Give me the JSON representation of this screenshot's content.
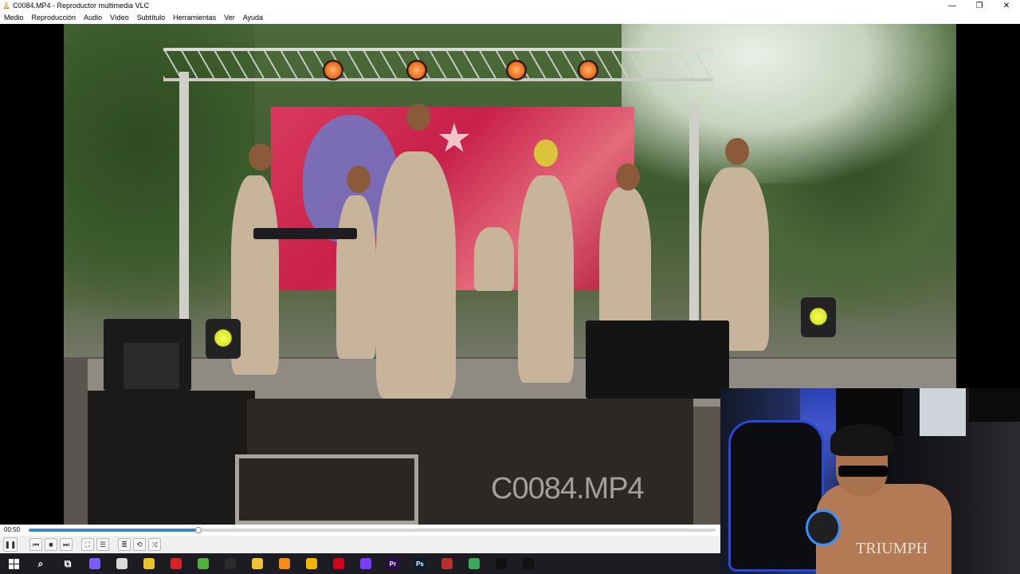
{
  "window": {
    "title": "C0084.MP4 - Reproductor multimedia VLC",
    "controls": {
      "minimize": "—",
      "restore": "❐",
      "close": "✕"
    }
  },
  "menu": [
    "Medio",
    "Reproducción",
    "Audio",
    "Vídeo",
    "Subtítulo",
    "Herramientas",
    "Ver",
    "Ayuda"
  ],
  "video": {
    "watermark": "C0084.MP4",
    "webcam_shirt_text": "TRIUMPH"
  },
  "playback": {
    "elapsed": "00:50",
    "progress_fraction": 0.247
  },
  "controls": {
    "play_pause": "❚❚",
    "prev": "⏮",
    "stop": "■",
    "next": "⏭",
    "fullscreen": "⛶",
    "extended": "☰",
    "playlist": "≣",
    "loop": "⟲",
    "random": "⤨"
  },
  "taskbar": {
    "apps": [
      {
        "name": "search-icon",
        "label": "⌕",
        "color": "#1c1c22"
      },
      {
        "name": "task-view-icon",
        "label": "⧉",
        "color": "#1c1c22"
      },
      {
        "name": "copilot-icon",
        "label": "",
        "color": "#7b5cff"
      },
      {
        "name": "files-icon",
        "label": "",
        "color": "#d9d9d9"
      },
      {
        "name": "app-yellow-icon",
        "label": "",
        "color": "#e9c429"
      },
      {
        "name": "capcut-red-icon",
        "label": "",
        "color": "#d8222a"
      },
      {
        "name": "app-green-icon",
        "label": "",
        "color": "#52b043"
      },
      {
        "name": "obs-icon",
        "label": "",
        "color": "#2b2b2b"
      },
      {
        "name": "file-explorer-icon",
        "label": "",
        "color": "#f1c232"
      },
      {
        "name": "vlc-icon",
        "label": "",
        "color": "#f28c1a"
      },
      {
        "name": "chrome-icon",
        "label": "",
        "color": "#f4b400"
      },
      {
        "name": "opera-icon",
        "label": "",
        "color": "#d0021b"
      },
      {
        "name": "app-purple-icon",
        "label": "",
        "color": "#7a3cff"
      },
      {
        "name": "premiere-icon",
        "label": "Pr",
        "color": "#2a0a55"
      },
      {
        "name": "photoshop-icon",
        "label": "Ps",
        "color": "#001e36"
      },
      {
        "name": "app-image-icon",
        "label": "",
        "color": "#b5312b"
      },
      {
        "name": "app-layers-icon",
        "label": "",
        "color": "#3da85a"
      },
      {
        "name": "capcut-icon",
        "label": "",
        "color": "#111111"
      },
      {
        "name": "capcut-2-icon",
        "label": "",
        "color": "#111111"
      }
    ]
  },
  "colors": {
    "seek_fill": "#3a87d8",
    "taskbar_bg": "#1c1c22"
  }
}
